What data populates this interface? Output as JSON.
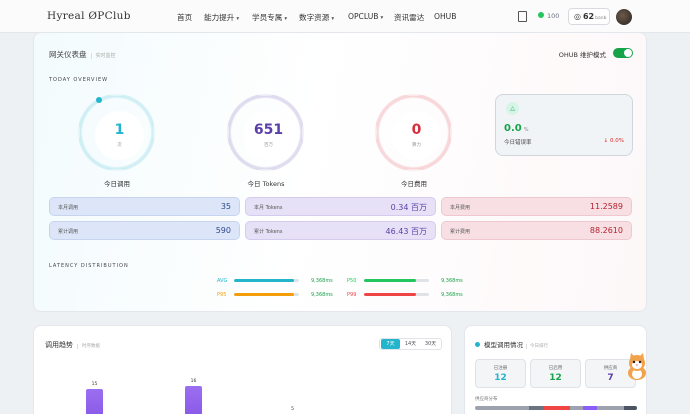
{
  "header": {
    "logo": "Hyreal ØPClub",
    "nav": [
      {
        "label": "首页",
        "caret": false
      },
      {
        "label": "能力提升",
        "caret": true
      },
      {
        "label": "学员专属",
        "caret": true
      },
      {
        "label": "数字资源",
        "caret": true
      },
      {
        "label": "OPCLUB",
        "caret": true
      },
      {
        "label": "资讯雷达",
        "caret": false
      },
      {
        "label": "OHUB",
        "caret": false
      }
    ],
    "credits": "100",
    "coins": "62",
    "coins_unit": "banb"
  },
  "dashboard": {
    "title": "网关仪表盘",
    "subtitle": "实时监控",
    "maintenance_label": "OHUB 维护模式",
    "today_overview": "TODAY OVERVIEW",
    "rings": [
      {
        "value": "1",
        "unit": "次",
        "label": "今日调用",
        "color": "#22b5cc"
      },
      {
        "value": "651",
        "unit": "百万",
        "label": "今日 Tokens",
        "color": "#5b3fa8"
      },
      {
        "value": "0",
        "unit": "算力",
        "label": "今日费用",
        "color": "#d62f3c"
      }
    ],
    "error": {
      "icon": "△",
      "value": "0.0",
      "unit": "%",
      "label": "今日错误率",
      "delta": "↓ 0.0%"
    },
    "stats": [
      {
        "label": "本月调用",
        "value": "35",
        "tone": "blue"
      },
      {
        "label": "本月 Tokens",
        "value": "0.34 百万",
        "tone": "purple"
      },
      {
        "label": "本月费用",
        "value": "11.2589",
        "tone": "red"
      },
      {
        "label": "累计调用",
        "value": "590",
        "tone": "blue"
      },
      {
        "label": "累计 Tokens",
        "value": "46.43 百万",
        "tone": "purple"
      },
      {
        "label": "累计费用",
        "value": "88.2610",
        "tone": "red"
      }
    ],
    "latency_title": "LATENCY DISTRIBUTION",
    "latency": [
      {
        "label": "AVG",
        "value": "9,368ms",
        "fill": 0.92,
        "color": "#22b5cc"
      },
      {
        "label": "P50",
        "value": "9,368ms",
        "fill": 0.8,
        "color": "#22c55e"
      },
      {
        "label": "P95",
        "value": "9,368ms",
        "fill": 0.92,
        "color": "#f59e0b"
      },
      {
        "label": "P99",
        "value": "9,368ms",
        "fill": 0.8,
        "color": "#ef4444"
      }
    ]
  },
  "trend": {
    "title": "调用趋势",
    "subtitle": "时序数据",
    "ranges": [
      "7天",
      "14天",
      "30天"
    ],
    "active_range": "7天",
    "chart_data": {
      "type": "bar",
      "values": [
        15,
        16,
        5
      ],
      "labels": [
        "15",
        "16",
        "5"
      ]
    }
  },
  "models": {
    "title": "模型调用情况",
    "subtitle": "今日排行",
    "boxes": [
      {
        "label": "已注册",
        "value": "12",
        "color": "#22b5cc"
      },
      {
        "label": "已启用",
        "value": "12",
        "color": "#16a34a"
      },
      {
        "label": "供应商",
        "value": "7",
        "color": "#5b3fa8"
      }
    ],
    "distribution_label": "供应商分布",
    "distribution_colors": [
      "#9ca3af",
      "#9ca3af",
      "#9ca3af",
      "#9ca3af",
      "#6b7280",
      "#ef4444",
      "#ef4444",
      "#9ca3af",
      "#8b5cf6",
      "#9ca3af",
      "#9ca3af",
      "#4b5563"
    ]
  }
}
